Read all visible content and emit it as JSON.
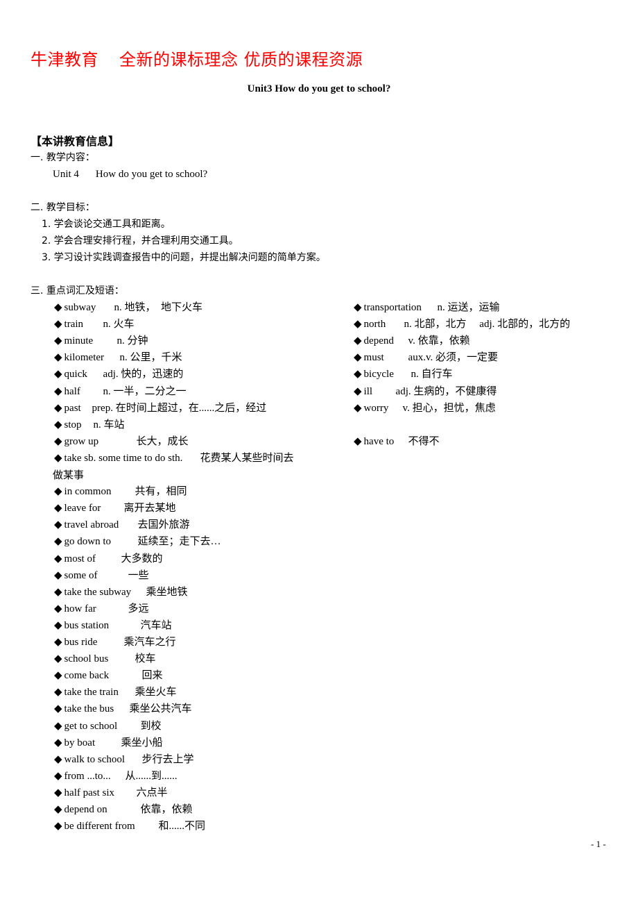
{
  "header": {
    "brand": "牛津教育",
    "slogan": "全新的课标理念 优质的课程资源",
    "accent_color": "#ff0000"
  },
  "title": "Unit3 How do you get to school?",
  "section_heading": "【本讲教育信息】",
  "part1": {
    "label": "一. 教学内容：",
    "content_unit": "Unit 4",
    "content_title": "How do you get to school?"
  },
  "part2": {
    "label": "二. 教学目标：",
    "goals": [
      "1. 学会谈论交通工具和距离。",
      "2. 学会合理安排行程，并合理利用交通工具。",
      "3. 学习设计实践调查报告中的问题，并提出解决问题的简单方案。"
    ]
  },
  "part3": {
    "label": "三. 重点词汇及短语：",
    "bullet_icon": "diamond-bullet",
    "left": [
      {
        "word": "subway",
        "def": "n. 地铁，　地下火车"
      },
      {
        "word": "train",
        "def": "n. 火车"
      },
      {
        "word": "minute",
        "def": "n. 分钟"
      },
      {
        "word": "kilometer",
        "def": "n. 公里，千米"
      },
      {
        "word": "quick",
        "def": "adj. 快的，迅速的"
      },
      {
        "word": "half",
        "def": "n. 一半，二分之一"
      },
      {
        "word": "past",
        "def": "prep. 在时间上超过，在......之后，经过"
      },
      {
        "word": "stop",
        "def": "n. 车站"
      },
      {
        "word": "grow up",
        "def": "长大，成长"
      },
      {
        "word": "take sb. some time to do sth.",
        "def": "花费某人某些时间去",
        "def_cont": "做某事"
      },
      {
        "word": "in common",
        "def": "共有，相同"
      },
      {
        "word": "leave for",
        "def": "离开去某地"
      },
      {
        "word": "travel abroad",
        "def": "去国外旅游"
      },
      {
        "word": "go down to",
        "def": "延续至；走下去…"
      },
      {
        "word": "most of",
        "def": "大多数的"
      },
      {
        "word": "some of",
        "def": "一些"
      },
      {
        "word": "take the subway",
        "def": "乘坐地铁"
      },
      {
        "word": "how far",
        "def": "多远"
      },
      {
        "word": "bus station",
        "def": "汽车站"
      },
      {
        "word": "bus ride",
        "def": "乘汽车之行"
      },
      {
        "word": "school bus",
        "def": "校车"
      },
      {
        "word": "come back",
        "def": "回来"
      },
      {
        "word": "take the train",
        "def": "乘坐火车"
      },
      {
        "word": "take the bus",
        "def": "乘坐公共汽车"
      },
      {
        "word": "get to school",
        "def": "到校"
      },
      {
        "word": "by boat",
        "def": "乘坐小船"
      },
      {
        "word": "walk to school",
        "def": "步行去上学"
      },
      {
        "word": "from ...to...",
        "def": "从......到......"
      },
      {
        "word": "half past six",
        "def": "六点半"
      },
      {
        "word": "depend on",
        "def": "依靠，依赖"
      },
      {
        "word": "be different from",
        "def": "和......不同"
      }
    ],
    "right": [
      {
        "word": "transportation",
        "def": "n. 运送，运输"
      },
      {
        "word": "north",
        "def": "n. 北部，北方　 adj. 北部的，北方的"
      },
      {
        "word": "depend",
        "def": "v. 依靠，依赖"
      },
      {
        "word": "must",
        "def": "aux.v. 必须，一定要"
      },
      {
        "word": "bicycle",
        "def": "n. 自行车"
      },
      {
        "word": "ill",
        "def": "adj. 生病的，不健康得"
      },
      {
        "word": "worry",
        "def": "v. 担心，担忧，焦虑"
      },
      {
        "word": "have to",
        "def": "不得不"
      }
    ]
  },
  "page_number": "- 1 -"
}
